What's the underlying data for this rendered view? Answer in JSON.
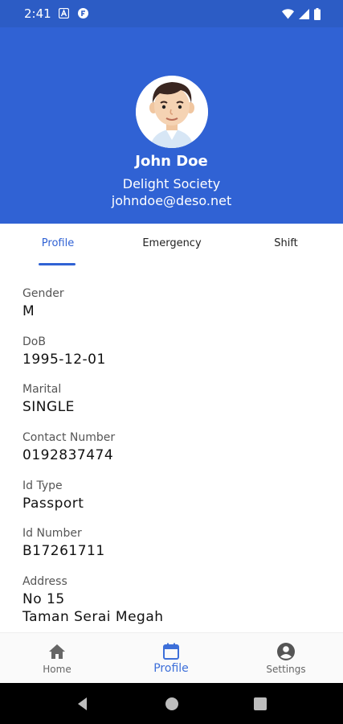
{
  "status_bar": {
    "time": "2:41",
    "icons": [
      "notification-a-icon",
      "notification-f-icon",
      "wifi-icon",
      "signal-icon",
      "battery-icon"
    ]
  },
  "profile": {
    "name": "John Doe",
    "organization": "Delight Society",
    "email": "johndoe@deso.net"
  },
  "tabs": [
    {
      "label": "Profile",
      "active": true
    },
    {
      "label": "Emergency",
      "active": false
    },
    {
      "label": "Shift",
      "active": false
    }
  ],
  "fields": {
    "gender": {
      "label": "Gender",
      "value": "M"
    },
    "dob": {
      "label": "DoB",
      "value": "1995-12-01"
    },
    "marital": {
      "label": "Marital",
      "value": "SINGLE"
    },
    "contact": {
      "label": "Contact Number",
      "value": "0192837474"
    },
    "id_type": {
      "label": "Id Type",
      "value": "Passport"
    },
    "id_number": {
      "label": "Id Number",
      "value": "B17261711"
    },
    "address": {
      "label": "Address",
      "line1": "No 15",
      "line2": "Taman Serai Megah"
    }
  },
  "bottom_nav": {
    "home": {
      "label": "Home",
      "icon": "home-icon"
    },
    "profile": {
      "label": "Profile",
      "icon": "calendar-icon",
      "active": true
    },
    "settings": {
      "label": "Settings",
      "icon": "account-circle-icon"
    }
  },
  "colors": {
    "header_bg": "#3062d4",
    "status_bg": "#2c5cc5",
    "accent": "#3062d4"
  }
}
